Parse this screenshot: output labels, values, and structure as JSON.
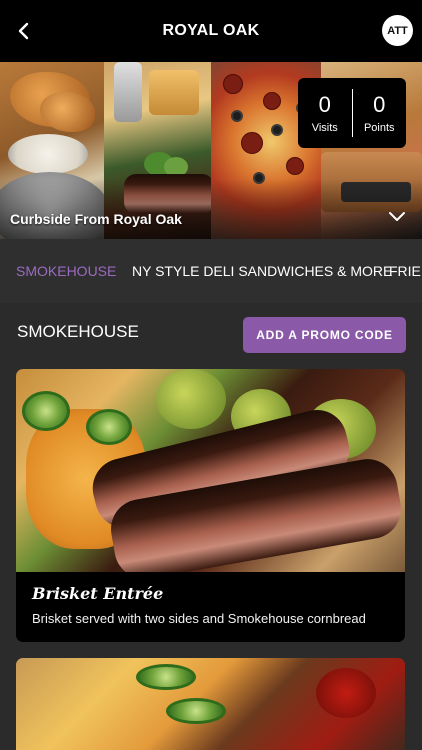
{
  "header": {
    "title": "ROYAL OAK",
    "avatar_initials": "ATT"
  },
  "hero": {
    "caption": "Curbside From Royal Oak",
    "stats": {
      "visits_value": "0",
      "visits_label": "Visits",
      "points_value": "0",
      "points_label": "Points"
    }
  },
  "tabs": [
    {
      "label": "SMOKEHOUSE",
      "active": true
    },
    {
      "label": "NY STYLE DELI SANDWICHES & MORE",
      "active": false
    },
    {
      "label": "FRIED",
      "active": false
    }
  ],
  "section": {
    "title": "SMOKEHOUSE",
    "promo_button": "ADD A PROMO CODE"
  },
  "items": [
    {
      "name": "Brisket Entrée",
      "description": "Brisket served with two sides and Smokehouse cornbread"
    }
  ],
  "colors": {
    "accent": "#8a5aa9",
    "active_tab": "#9b6bc1",
    "background": "#2b2b2b",
    "topbar": "#000000"
  },
  "icons": [
    "chevron-left-icon",
    "chevron-down-icon"
  ]
}
